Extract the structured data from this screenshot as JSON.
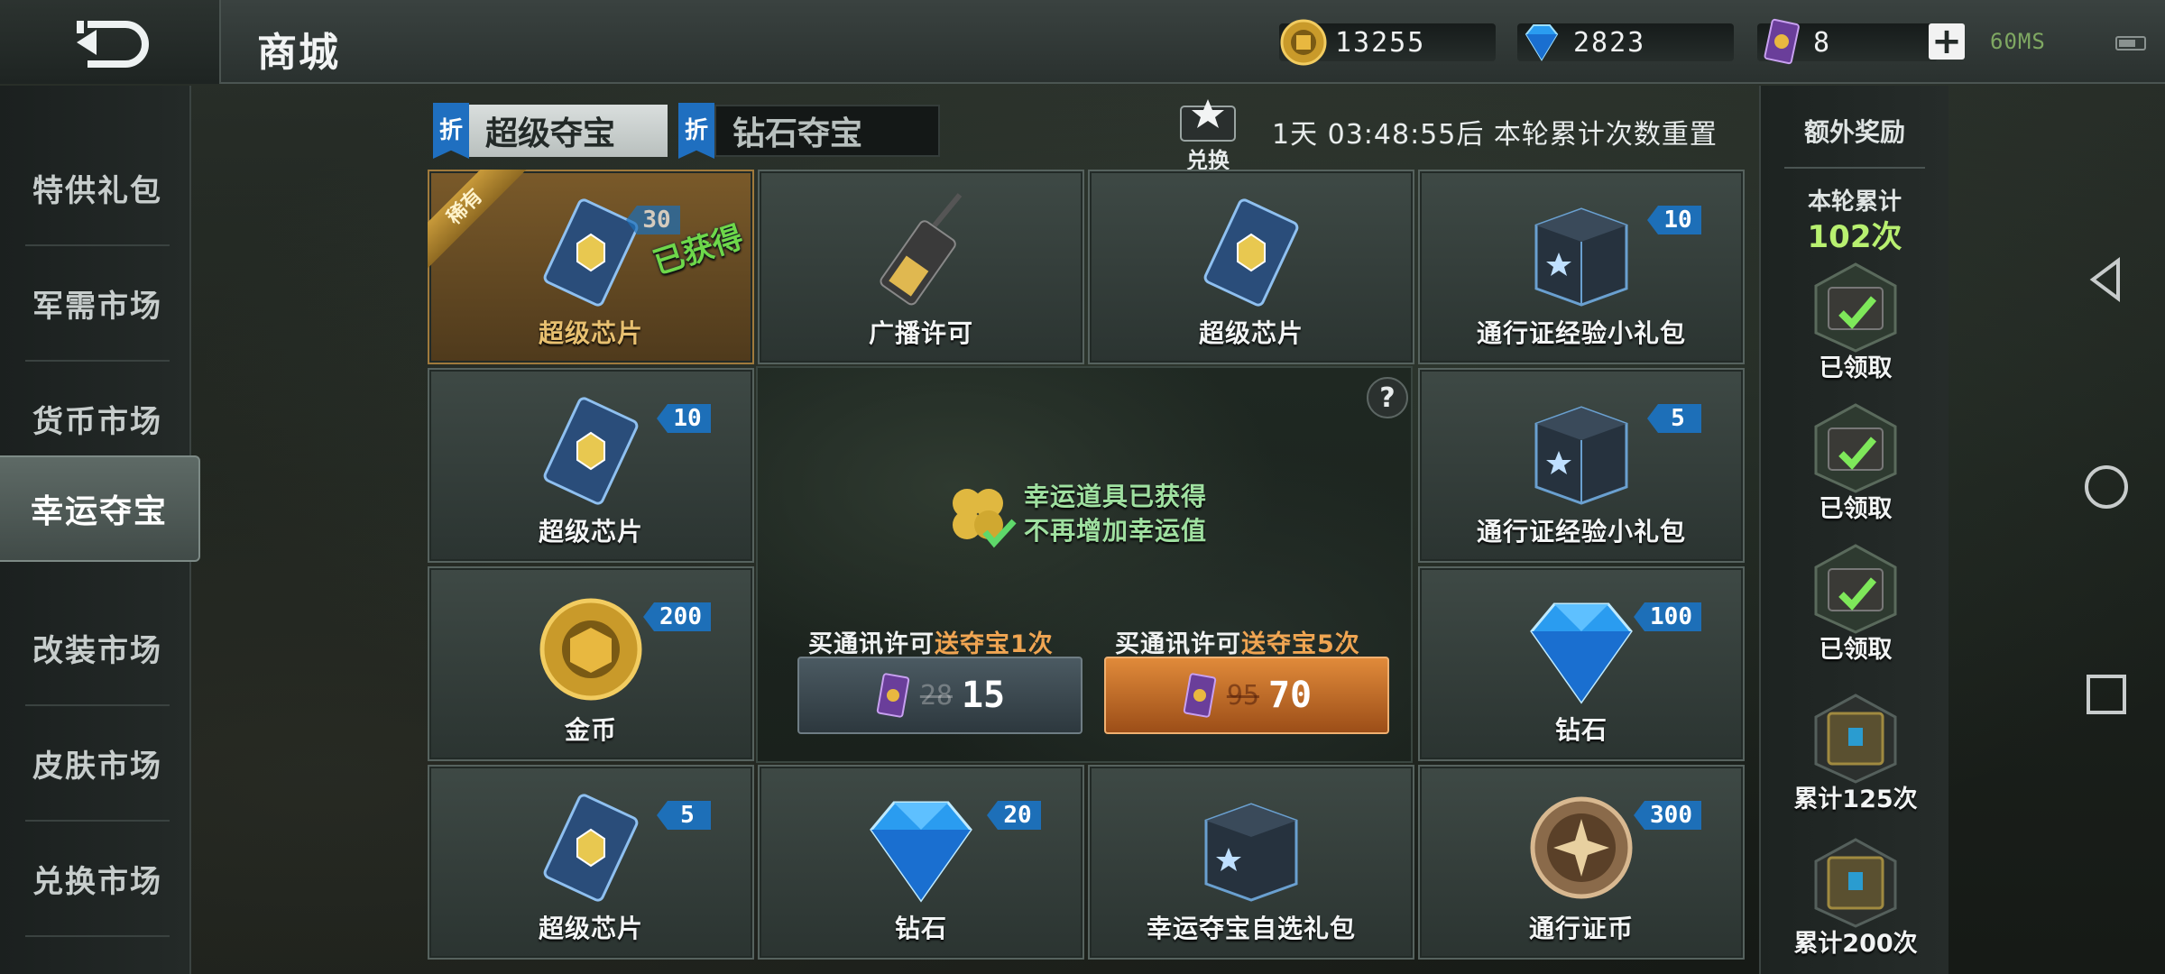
{
  "header": {
    "title": "商城",
    "gold": "13255",
    "diamond": "2823",
    "pass": "8",
    "plus": "+",
    "ping": "60MS"
  },
  "sidebar": {
    "items": [
      {
        "label": "特供礼包"
      },
      {
        "label": "军需市场"
      },
      {
        "label": "货币市场"
      },
      {
        "label": "幸运夺宝"
      },
      {
        "label": "改装市场"
      },
      {
        "label": "皮肤市场"
      },
      {
        "label": "兑换市场"
      }
    ]
  },
  "tabs": {
    "flag": "折",
    "super": "超级夺宝",
    "diamond": "钻石夺宝"
  },
  "exchange": {
    "label": "兑换"
  },
  "reset_text": "1天 03:48:55后 本轮累计次数重置",
  "grid": {
    "items": [
      {
        "name": "超级芯片",
        "qty": "",
        "owned_ribbon": "稀有",
        "stamp": "已获得",
        "hidden_qty": "30"
      },
      {
        "name": "广播许可",
        "qty": ""
      },
      {
        "name": "超级芯片",
        "qty": ""
      },
      {
        "name": "通行证经验小礼包",
        "qty": "10"
      },
      {
        "name": "超级芯片",
        "qty": "10"
      },
      {
        "name": "通行证经验小礼包",
        "qty": "5"
      },
      {
        "name": "金币",
        "qty": "200"
      },
      {
        "name": "钻石",
        "qty": "100"
      },
      {
        "name": "超级芯片",
        "qty": "5"
      },
      {
        "name": "钻石",
        "qty": "20"
      },
      {
        "name": "幸运夺宝自选礼包",
        "qty": ""
      },
      {
        "name": "通行证币",
        "qty": "300"
      }
    ]
  },
  "center": {
    "help": "?",
    "luck_line1": "幸运道具已获得",
    "luck_line2": "不再增加幸运值",
    "buy1": {
      "prefix": "买通讯许可",
      "highlight": "送夺宝1次",
      "old": "28",
      "new": "15"
    },
    "buy5": {
      "prefix": "买通讯许可",
      "highlight": "送夺宝5次",
      "old": "95",
      "new": "70"
    }
  },
  "rewards": {
    "title": "额外奖励",
    "round_label": "本轮累计",
    "round_count": "102次",
    "tiers": [
      {
        "label": "已领取"
      },
      {
        "label": "已领取"
      },
      {
        "label": "已领取"
      },
      {
        "label": "累计125次"
      },
      {
        "label": "累计200次"
      }
    ]
  },
  "colors": {
    "accent_blue": "#1d6fb8",
    "buy5_orange": "#e08a3a",
    "highlight_text": "#f0a552",
    "count_green": "#b8f070"
  }
}
